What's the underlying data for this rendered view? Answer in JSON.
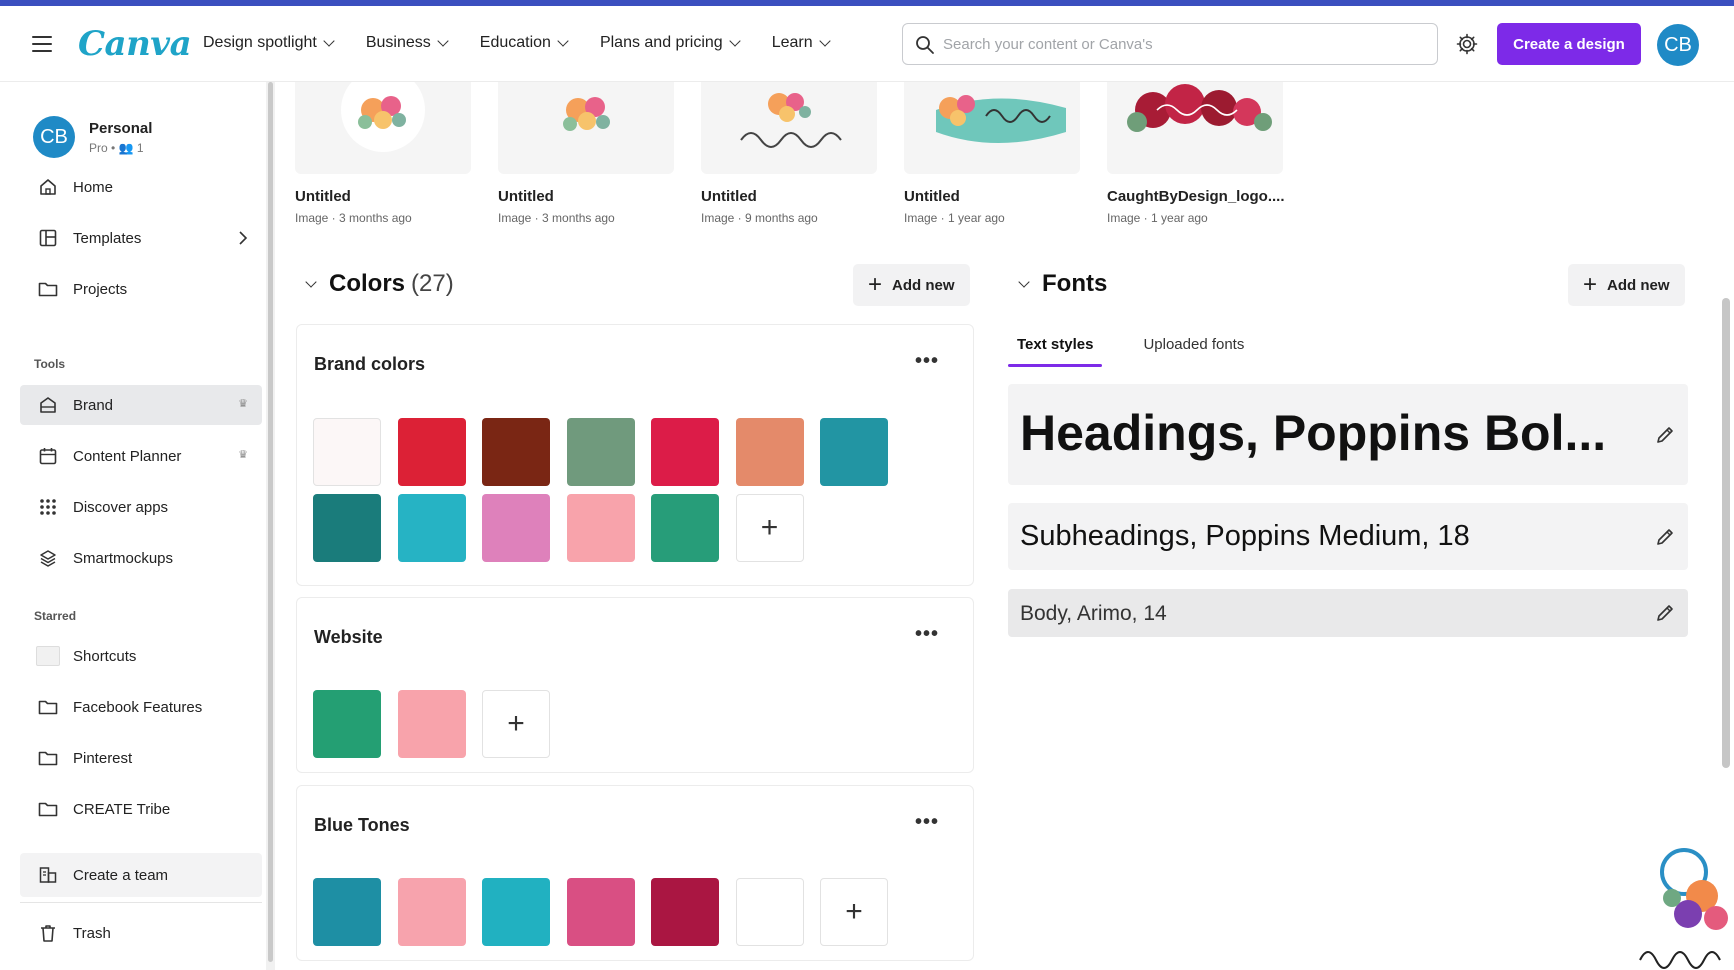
{
  "header": {
    "logo": "Canva",
    "nav": [
      "Design spotlight",
      "Business",
      "Education",
      "Plans and pricing",
      "Learn"
    ],
    "search_placeholder": "Search your content or Canva's",
    "create_button": "Create a design",
    "avatar_initials": "CB"
  },
  "sidebar": {
    "account": {
      "initials": "CB",
      "name": "Personal",
      "sub": "Pro • 👥 1"
    },
    "main_items": [
      "Home",
      "Templates",
      "Projects"
    ],
    "tools_label": "Tools",
    "tools": [
      "Brand",
      "Content Planner",
      "Discover apps",
      "Smartmockups"
    ],
    "starred_label": "Starred",
    "starred": [
      "Shortcuts",
      "Facebook Features",
      "Pinterest",
      "CREATE Tribe"
    ],
    "create_team": "Create a team",
    "trash": "Trash"
  },
  "thumbnails": [
    {
      "title": "Untitled",
      "meta": "Image · 3 months ago"
    },
    {
      "title": "Untitled",
      "meta": "Image · 3 months ago"
    },
    {
      "title": "Untitled",
      "meta": "Image · 9 months ago"
    },
    {
      "title": "Untitled",
      "meta": "Image · 1 year ago"
    },
    {
      "title": "CaughtByDesign_logo....",
      "meta": "Image · 1 year ago"
    }
  ],
  "colors": {
    "title": "Colors",
    "count": "(27)",
    "add_new": "Add new",
    "palettes": [
      {
        "name": "Brand colors",
        "swatches": [
          "#fcf7f7",
          "#dc2136",
          "#7a2614",
          "#709a7d",
          "#dc1c48",
          "#e48a6a",
          "#2295a3",
          "#1a7c7b",
          "#26b3c4",
          "#de81bb",
          "#f8a3ab",
          "#279d79"
        ]
      },
      {
        "name": "Website",
        "swatches": [
          "#249f73",
          "#f8a3ab"
        ]
      },
      {
        "name": "Blue Tones",
        "swatches": [
          "#1e8fa4",
          "#f7a3ad",
          "#21b1c1",
          "#d94f83",
          "#aa1642",
          "#ffffff"
        ]
      }
    ]
  },
  "fonts": {
    "title": "Fonts",
    "add_new": "Add new",
    "tabs": [
      "Text styles",
      "Uploaded fonts"
    ],
    "styles": [
      "Headings, Poppins Bol...",
      "Subheadings, Poppins Medium, 18",
      "Body, Arimo, 14"
    ]
  }
}
